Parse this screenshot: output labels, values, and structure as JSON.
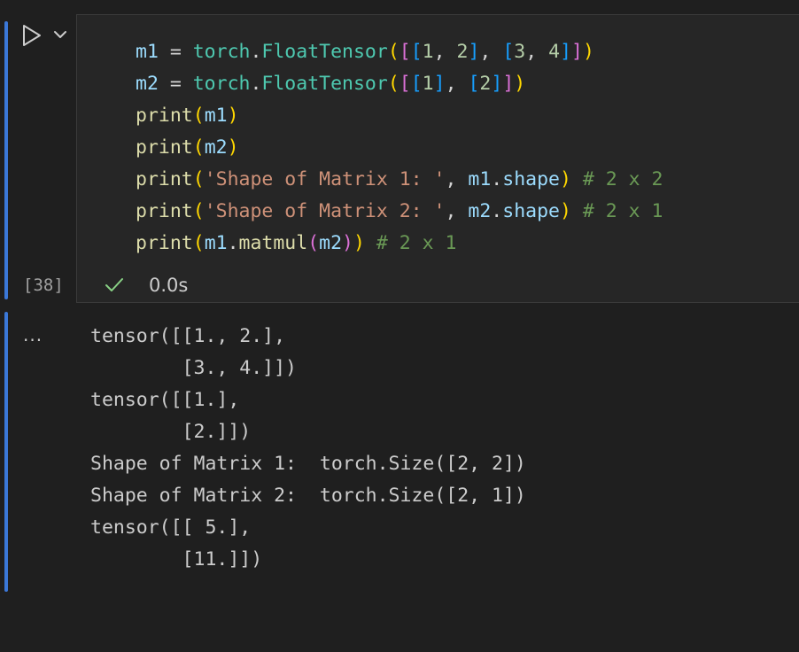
{
  "cell": {
    "execution_count": "[38]",
    "duration": "0.0s",
    "run_icon": "play-icon",
    "chevron_icon": "chevron-down-icon",
    "status_icon": "check-icon",
    "more_label": "...",
    "code_lines": [
      "m1 = torch.FloatTensor([[1, 2], [3, 4]])",
      "m2 = torch.FloatTensor([[1], [2]])",
      "print(m1)",
      "print(m2)",
      "print('Shape of Matrix 1: ', m1.shape) # 2 x 2",
      "print('Shape of Matrix 2: ', m2.shape) # 2 x 1",
      "print(m1.matmul(m2)) # 2 x 1"
    ],
    "output_lines": [
      "tensor([[1., 2.],",
      "        [3., 4.]])",
      "tensor([[1.],",
      "        [2.]])",
      "Shape of Matrix 1:  torch.Size([2, 2])",
      "Shape of Matrix 2:  torch.Size([2, 1])",
      "tensor([[ 5.],",
      "        [11.]])"
    ]
  },
  "colors": {
    "accent_bar": "#3b78d8",
    "success_check": "#89d185",
    "editor_bg": "#262626",
    "page_bg": "#1f1f1f"
  }
}
